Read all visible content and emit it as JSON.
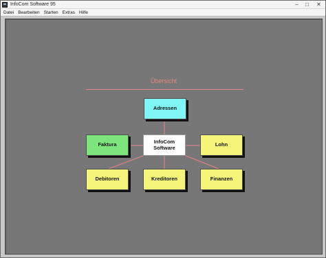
{
  "window": {
    "title": "InfoCom Software 95",
    "controls": {
      "minimize": "–",
      "maximize": "□",
      "close": "✕"
    }
  },
  "menu": [
    "Datei",
    "Bearbeiten",
    "Starten",
    "Extras",
    "Hilfe"
  ],
  "overview": {
    "heading": "Übersicht",
    "heading_color": "#e88585",
    "center": {
      "line1": "InfoCom",
      "line2": "Software",
      "color": "#ffffff"
    },
    "modules": {
      "adressen": {
        "label": "Adressen",
        "color": "#80f5f5"
      },
      "faktura": {
        "label": "Faktura",
        "color": "#7ce67c"
      },
      "lohn": {
        "label": "Lohn",
        "color": "#f5f57a"
      },
      "debitoren": {
        "label": "Debitoren",
        "color": "#f5f57a"
      },
      "kreditoren": {
        "label": "Kreditoren",
        "color": "#f5f57a"
      },
      "finanzen": {
        "label": "Finanzen",
        "color": "#f5f57a"
      }
    },
    "connector_color": "#e88585"
  }
}
